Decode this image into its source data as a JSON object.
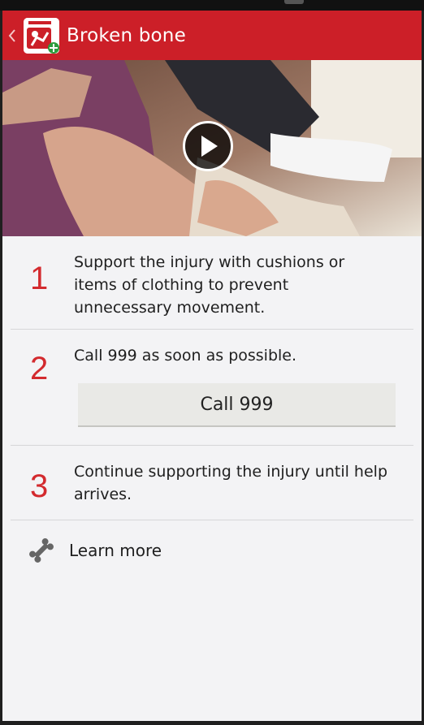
{
  "header": {
    "title": "Broken bone"
  },
  "video": {
    "play_icon": "play-icon"
  },
  "steps": [
    {
      "number": "1",
      "text": "Support the injury with cushions or items of clothing to prevent unnecessary movement."
    },
    {
      "number": "2",
      "text": "Call 999 as soon as possible.",
      "button_label": "Call 999"
    },
    {
      "number": "3",
      "text": "Continue supporting the injury until help arrives."
    }
  ],
  "learn_more": {
    "label": "Learn more",
    "icon": "bone-icon"
  },
  "colors": {
    "brand_red": "#cc1f28",
    "step_number_red": "#d32a2e"
  }
}
